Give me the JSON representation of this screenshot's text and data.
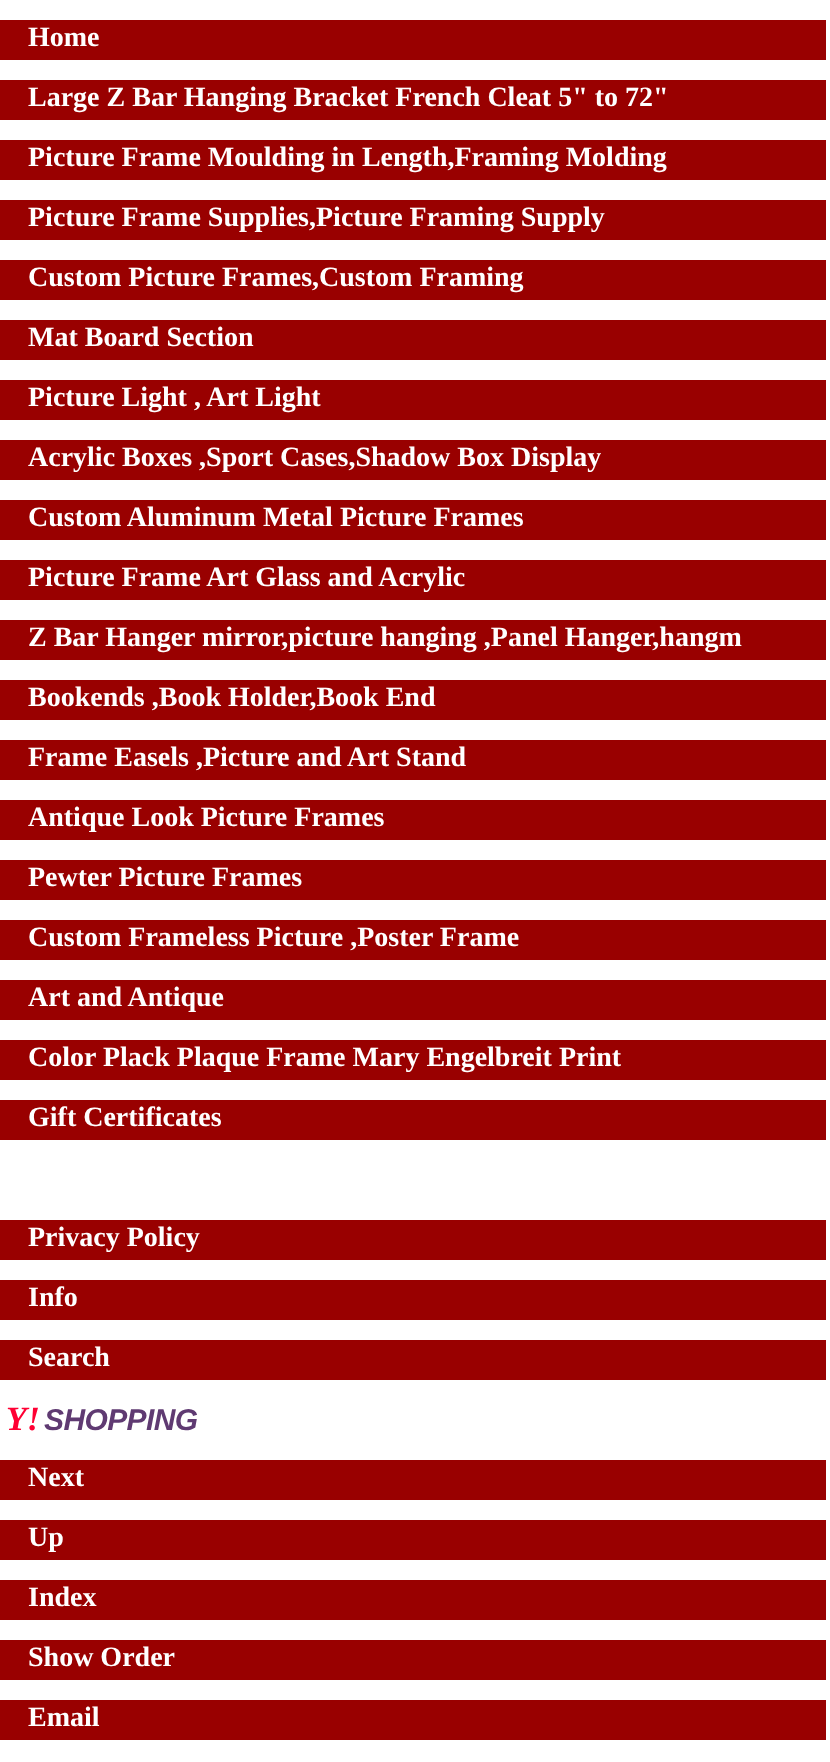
{
  "menu": [
    {
      "kind": "link",
      "label": "Home"
    },
    {
      "kind": "link",
      "label": "Large Z Bar Hanging Bracket French Cleat 5\" to 72\""
    },
    {
      "kind": "link",
      "label": "Picture Frame Moulding in Length,Framing Molding"
    },
    {
      "kind": "link",
      "label": "Picture Frame Supplies,Picture Framing Supply"
    },
    {
      "kind": "link",
      "label": "Custom Picture Frames,Custom Framing"
    },
    {
      "kind": "link",
      "label": "Mat Board Section"
    },
    {
      "kind": "link",
      "label": "Picture Light , Art Light"
    },
    {
      "kind": "link",
      "label": "Acrylic Boxes ,Sport Cases,Shadow Box Display"
    },
    {
      "kind": "link",
      "label": "Custom Aluminum Metal Picture Frames"
    },
    {
      "kind": "link",
      "label": "Picture Frame Art Glass and Acrylic"
    },
    {
      "kind": "link",
      "label": "Z Bar Hanger mirror,picture hanging ,Panel Hanger,hangm"
    },
    {
      "kind": "link",
      "label": "Bookends ,Book Holder,Book End"
    },
    {
      "kind": "link",
      "label": "Frame Easels ,Picture and Art Stand"
    },
    {
      "kind": "link",
      "label": "Antique Look Picture Frames"
    },
    {
      "kind": "link",
      "label": "Pewter Picture Frames"
    },
    {
      "kind": "link",
      "label": "Custom Frameless Picture ,Poster Frame"
    },
    {
      "kind": "link",
      "label": "Art and Antique"
    },
    {
      "kind": "link",
      "label": "Color Plack Plaque Frame Mary Engelbreit Print"
    },
    {
      "kind": "link",
      "label": "Gift Certificates"
    },
    {
      "kind": "spacer"
    },
    {
      "kind": "link",
      "label": "Privacy Policy"
    },
    {
      "kind": "link",
      "label": "Info"
    },
    {
      "kind": "link",
      "label": "Search"
    },
    {
      "kind": "logo",
      "mark": "Y!",
      "label": "SHOPPING"
    },
    {
      "kind": "link",
      "label": "Next"
    },
    {
      "kind": "link",
      "label": "Up"
    },
    {
      "kind": "link",
      "label": "Index"
    },
    {
      "kind": "link",
      "label": "Show Order"
    },
    {
      "kind": "link",
      "label": "Email"
    }
  ]
}
